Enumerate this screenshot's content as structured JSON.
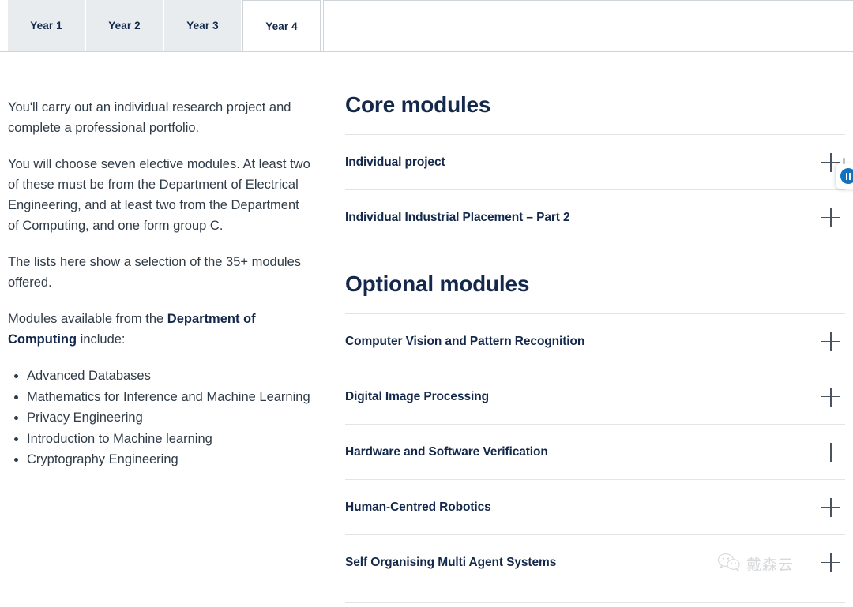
{
  "tabs": {
    "items": [
      {
        "label": "Year 1",
        "active": false
      },
      {
        "label": "Year 2",
        "active": false
      },
      {
        "label": "Year 3",
        "active": false
      },
      {
        "label": "Year 4",
        "active": true
      }
    ]
  },
  "left_column": {
    "paragraphs": [
      "You'll carry out an individual research project and complete a professional portfolio.",
      "You will choose seven elective modules. At least two of these must be from the Department of Electrical Engineering, and at least two from the Department of Computing, and one form group C.",
      "The lists here show a selection of the 35+ modules offered."
    ],
    "intro_prefix": "Modules available from the ",
    "intro_bold": "Department of Computing",
    "intro_suffix": " include:",
    "modules_list": [
      "Advanced Databases",
      "Mathematics for Inference and Machine Learning",
      "Privacy Engineering",
      "Introduction to Machine learning",
      "Cryptography Engineering"
    ]
  },
  "right_column": {
    "core": {
      "title": "Core modules",
      "items": [
        {
          "label": "Individual project",
          "icon": "plus-icon"
        },
        {
          "label": "Individual Industrial Placement – Part 2",
          "icon": "plus-icon"
        }
      ]
    },
    "optional": {
      "title": "Optional modules",
      "items": [
        {
          "label": "Computer Vision and Pattern Recognition",
          "icon": "plus-icon"
        },
        {
          "label": "Digital Image Processing",
          "icon": "plus-icon"
        },
        {
          "label": "Hardware and Software Verification",
          "icon": "plus-icon"
        },
        {
          "label": "Human-Centred Robotics",
          "icon": "plus-icon"
        },
        {
          "label": "Self Organising Multi Agent Systems",
          "icon": "plus-icon"
        }
      ]
    }
  },
  "overlay": {
    "pause_widget": {
      "icon": "pause-icon",
      "accent_color": "#1372bd"
    }
  },
  "watermark": {
    "icon": "wechat-icon",
    "text": "戴森云"
  },
  "colors": {
    "heading": "#13284b",
    "body_text": "#2f3b47",
    "tab_inactive_bg": "#e8ecee",
    "divider": "#e2e5e8",
    "accent": "#1372bd"
  }
}
